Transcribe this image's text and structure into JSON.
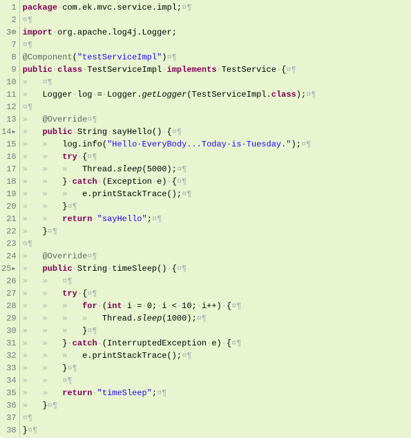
{
  "lines": [
    {
      "n": "1",
      "marker": "",
      "segs": [
        {
          "t": "package",
          "c": "kw"
        },
        {
          "t": "·",
          "c": "ws"
        },
        {
          "t": "com.ek.mvc.service.impl;"
        },
        {
          "t": "¤¶",
          "c": "ws"
        }
      ]
    },
    {
      "n": "2",
      "marker": "",
      "segs": [
        {
          "t": "¤¶",
          "c": "ws"
        }
      ]
    },
    {
      "n": "3",
      "marker": "⊕",
      "segs": [
        {
          "t": "import",
          "c": "kw"
        },
        {
          "t": "·",
          "c": "ws"
        },
        {
          "t": "org.apache.log4j.Logger;"
        }
      ]
    },
    {
      "n": "7",
      "marker": "",
      "segs": [
        {
          "t": "¤¶",
          "c": "ws"
        }
      ]
    },
    {
      "n": "8",
      "marker": "",
      "segs": [
        {
          "t": "@Component",
          "c": "ann"
        },
        {
          "t": "("
        },
        {
          "t": "\"testServiceImpl\"",
          "c": "str"
        },
        {
          "t": ")"
        },
        {
          "t": "¤¶",
          "c": "ws"
        }
      ]
    },
    {
      "n": "9",
      "marker": "",
      "segs": [
        {
          "t": "public",
          "c": "kw"
        },
        {
          "t": "·",
          "c": "ws"
        },
        {
          "t": "class",
          "c": "kw"
        },
        {
          "t": "·",
          "c": "ws"
        },
        {
          "t": "TestServiceImpl"
        },
        {
          "t": "·",
          "c": "ws"
        },
        {
          "t": "implements",
          "c": "kw"
        },
        {
          "t": "·",
          "c": "ws"
        },
        {
          "t": "TestService"
        },
        {
          "t": "·",
          "c": "ws"
        },
        {
          "t": "{"
        },
        {
          "t": "¤¶",
          "c": "ws"
        }
      ]
    },
    {
      "n": "10",
      "marker": "",
      "segs": [
        {
          "t": "»   ",
          "c": "ws"
        },
        {
          "t": "¤¶",
          "c": "ws"
        }
      ]
    },
    {
      "n": "11",
      "marker": "",
      "segs": [
        {
          "t": "»   ",
          "c": "ws"
        },
        {
          "t": "Logger"
        },
        {
          "t": "·",
          "c": "ws"
        },
        {
          "t": "log"
        },
        {
          "t": "·",
          "c": "ws"
        },
        {
          "t": "="
        },
        {
          "t": "·",
          "c": "ws"
        },
        {
          "t": "Logger."
        },
        {
          "t": "getLogger",
          "c": "it"
        },
        {
          "t": "(TestServiceImpl."
        },
        {
          "t": "class",
          "c": "kw"
        },
        {
          "t": ");"
        },
        {
          "t": "¤¶",
          "c": "ws"
        }
      ]
    },
    {
      "n": "12",
      "marker": "",
      "segs": [
        {
          "t": "¤¶",
          "c": "ws"
        }
      ]
    },
    {
      "n": "13",
      "marker": "",
      "segs": [
        {
          "t": "»   ",
          "c": "ws"
        },
        {
          "t": "@Override",
          "c": "ann"
        },
        {
          "t": "¤¶",
          "c": "ws"
        }
      ]
    },
    {
      "n": "14",
      "marker": "▸",
      "segs": [
        {
          "t": "»   ",
          "c": "ws"
        },
        {
          "t": "public",
          "c": "kw"
        },
        {
          "t": "·",
          "c": "ws"
        },
        {
          "t": "String"
        },
        {
          "t": "·",
          "c": "ws"
        },
        {
          "t": "sayHello()"
        },
        {
          "t": "·",
          "c": "ws"
        },
        {
          "t": "{"
        },
        {
          "t": "¤¶",
          "c": "ws"
        }
      ]
    },
    {
      "n": "15",
      "marker": "",
      "segs": [
        {
          "t": "»   »   ",
          "c": "ws"
        },
        {
          "t": "log.info("
        },
        {
          "t": "\"Hello·EveryBody...Today·is·Tuesday.\"",
          "c": "str"
        },
        {
          "t": ");"
        },
        {
          "t": "¤¶",
          "c": "ws"
        }
      ]
    },
    {
      "n": "16",
      "marker": "",
      "segs": [
        {
          "t": "»   »   ",
          "c": "ws"
        },
        {
          "t": "try",
          "c": "kw"
        },
        {
          "t": "·",
          "c": "ws"
        },
        {
          "t": "{"
        },
        {
          "t": "¤¶",
          "c": "ws"
        }
      ]
    },
    {
      "n": "17",
      "marker": "",
      "segs": [
        {
          "t": "»   »   »   ",
          "c": "ws"
        },
        {
          "t": "Thread."
        },
        {
          "t": "sleep",
          "c": "it"
        },
        {
          "t": "(5000);"
        },
        {
          "t": "¤¶",
          "c": "ws"
        }
      ]
    },
    {
      "n": "18",
      "marker": "",
      "segs": [
        {
          "t": "»   »   ",
          "c": "ws"
        },
        {
          "t": "}"
        },
        {
          "t": "·",
          "c": "ws"
        },
        {
          "t": "catch",
          "c": "kw"
        },
        {
          "t": "·",
          "c": "ws"
        },
        {
          "t": "(Exception"
        },
        {
          "t": "·",
          "c": "ws"
        },
        {
          "t": "e)"
        },
        {
          "t": "·",
          "c": "ws"
        },
        {
          "t": "{"
        },
        {
          "t": "¤¶",
          "c": "ws"
        }
      ]
    },
    {
      "n": "19",
      "marker": "",
      "segs": [
        {
          "t": "»   »   »   ",
          "c": "ws"
        },
        {
          "t": "e.printStackTrace();"
        },
        {
          "t": "¤¶",
          "c": "ws"
        }
      ]
    },
    {
      "n": "20",
      "marker": "",
      "segs": [
        {
          "t": "»   »   ",
          "c": "ws"
        },
        {
          "t": "}"
        },
        {
          "t": "¤¶",
          "c": "ws"
        }
      ]
    },
    {
      "n": "21",
      "marker": "",
      "segs": [
        {
          "t": "»   »   ",
          "c": "ws"
        },
        {
          "t": "return",
          "c": "kw"
        },
        {
          "t": "·",
          "c": "ws"
        },
        {
          "t": "\"sayHello\"",
          "c": "str"
        },
        {
          "t": ";"
        },
        {
          "t": "¤¶",
          "c": "ws"
        }
      ]
    },
    {
      "n": "22",
      "marker": "",
      "segs": [
        {
          "t": "»   ",
          "c": "ws"
        },
        {
          "t": "}"
        },
        {
          "t": "¤¶",
          "c": "ws"
        }
      ]
    },
    {
      "n": "23",
      "marker": "",
      "segs": [
        {
          "t": "¤¶",
          "c": "ws"
        }
      ]
    },
    {
      "n": "24",
      "marker": "",
      "segs": [
        {
          "t": "»   ",
          "c": "ws"
        },
        {
          "t": "@Override",
          "c": "ann"
        },
        {
          "t": "¤¶",
          "c": "ws"
        }
      ]
    },
    {
      "n": "25",
      "marker": "▸",
      "segs": [
        {
          "t": "»   ",
          "c": "ws"
        },
        {
          "t": "public",
          "c": "kw"
        },
        {
          "t": "·",
          "c": "ws"
        },
        {
          "t": "String"
        },
        {
          "t": "·",
          "c": "ws"
        },
        {
          "t": "timeSleep()"
        },
        {
          "t": "·",
          "c": "ws"
        },
        {
          "t": "{"
        },
        {
          "t": "¤¶",
          "c": "ws"
        }
      ]
    },
    {
      "n": "26",
      "marker": "",
      "segs": [
        {
          "t": "»   »   ",
          "c": "ws"
        },
        {
          "t": "¤¶",
          "c": "ws"
        }
      ]
    },
    {
      "n": "27",
      "marker": "",
      "segs": [
        {
          "t": "»   »   ",
          "c": "ws"
        },
        {
          "t": "try",
          "c": "kw"
        },
        {
          "t": "·",
          "c": "ws"
        },
        {
          "t": "{"
        },
        {
          "t": "¤¶",
          "c": "ws"
        }
      ]
    },
    {
      "n": "28",
      "marker": "",
      "segs": [
        {
          "t": "»   »   »   ",
          "c": "ws"
        },
        {
          "t": "for",
          "c": "kw"
        },
        {
          "t": "·",
          "c": "ws"
        },
        {
          "t": "("
        },
        {
          "t": "int",
          "c": "kw"
        },
        {
          "t": "·",
          "c": "ws"
        },
        {
          "t": "i"
        },
        {
          "t": "·",
          "c": "ws"
        },
        {
          "t": "="
        },
        {
          "t": "·",
          "c": "ws"
        },
        {
          "t": "0;"
        },
        {
          "t": "·",
          "c": "ws"
        },
        {
          "t": "i"
        },
        {
          "t": "·",
          "c": "ws"
        },
        {
          "t": "<"
        },
        {
          "t": "·",
          "c": "ws"
        },
        {
          "t": "10;"
        },
        {
          "t": "·",
          "c": "ws"
        },
        {
          "t": "i++)"
        },
        {
          "t": "·",
          "c": "ws"
        },
        {
          "t": "{"
        },
        {
          "t": "¤¶",
          "c": "ws"
        }
      ]
    },
    {
      "n": "29",
      "marker": "",
      "segs": [
        {
          "t": "»   »   »   »   ",
          "c": "ws"
        },
        {
          "t": "Thread."
        },
        {
          "t": "sleep",
          "c": "it"
        },
        {
          "t": "(1000);"
        },
        {
          "t": "¤¶",
          "c": "ws"
        }
      ]
    },
    {
      "n": "30",
      "marker": "",
      "segs": [
        {
          "t": "»   »   »   ",
          "c": "ws"
        },
        {
          "t": "}"
        },
        {
          "t": "¤¶",
          "c": "ws"
        }
      ]
    },
    {
      "n": "31",
      "marker": "",
      "segs": [
        {
          "t": "»   »   ",
          "c": "ws"
        },
        {
          "t": "}"
        },
        {
          "t": "·",
          "c": "ws"
        },
        {
          "t": "catch",
          "c": "kw"
        },
        {
          "t": "·",
          "c": "ws"
        },
        {
          "t": "(InterruptedException"
        },
        {
          "t": "·",
          "c": "ws"
        },
        {
          "t": "e)"
        },
        {
          "t": "·",
          "c": "ws"
        },
        {
          "t": "{"
        },
        {
          "t": "¤¶",
          "c": "ws"
        }
      ]
    },
    {
      "n": "32",
      "marker": "",
      "segs": [
        {
          "t": "»   »   »   ",
          "c": "ws"
        },
        {
          "t": "e.printStackTrace();"
        },
        {
          "t": "¤¶",
          "c": "ws"
        }
      ]
    },
    {
      "n": "33",
      "marker": "",
      "segs": [
        {
          "t": "»   »   ",
          "c": "ws"
        },
        {
          "t": "}"
        },
        {
          "t": "¤¶",
          "c": "ws"
        }
      ]
    },
    {
      "n": "34",
      "marker": "",
      "segs": [
        {
          "t": "»   »   ",
          "c": "ws"
        },
        {
          "t": "¤¶",
          "c": "ws"
        }
      ]
    },
    {
      "n": "35",
      "marker": "",
      "segs": [
        {
          "t": "»   »   ",
          "c": "ws"
        },
        {
          "t": "return",
          "c": "kw"
        },
        {
          "t": "·",
          "c": "ws"
        },
        {
          "t": "\"timeSleep\"",
          "c": "str"
        },
        {
          "t": ";"
        },
        {
          "t": "¤¶",
          "c": "ws"
        }
      ]
    },
    {
      "n": "36",
      "marker": "",
      "segs": [
        {
          "t": "»   ",
          "c": "ws"
        },
        {
          "t": "}"
        },
        {
          "t": "¤¶",
          "c": "ws"
        }
      ]
    },
    {
      "n": "37",
      "marker": "",
      "segs": [
        {
          "t": "¤¶",
          "c": "ws"
        }
      ]
    },
    {
      "n": "38",
      "marker": "",
      "segs": [
        {
          "t": "}"
        },
        {
          "t": "¤¶",
          "c": "ws"
        }
      ]
    }
  ]
}
